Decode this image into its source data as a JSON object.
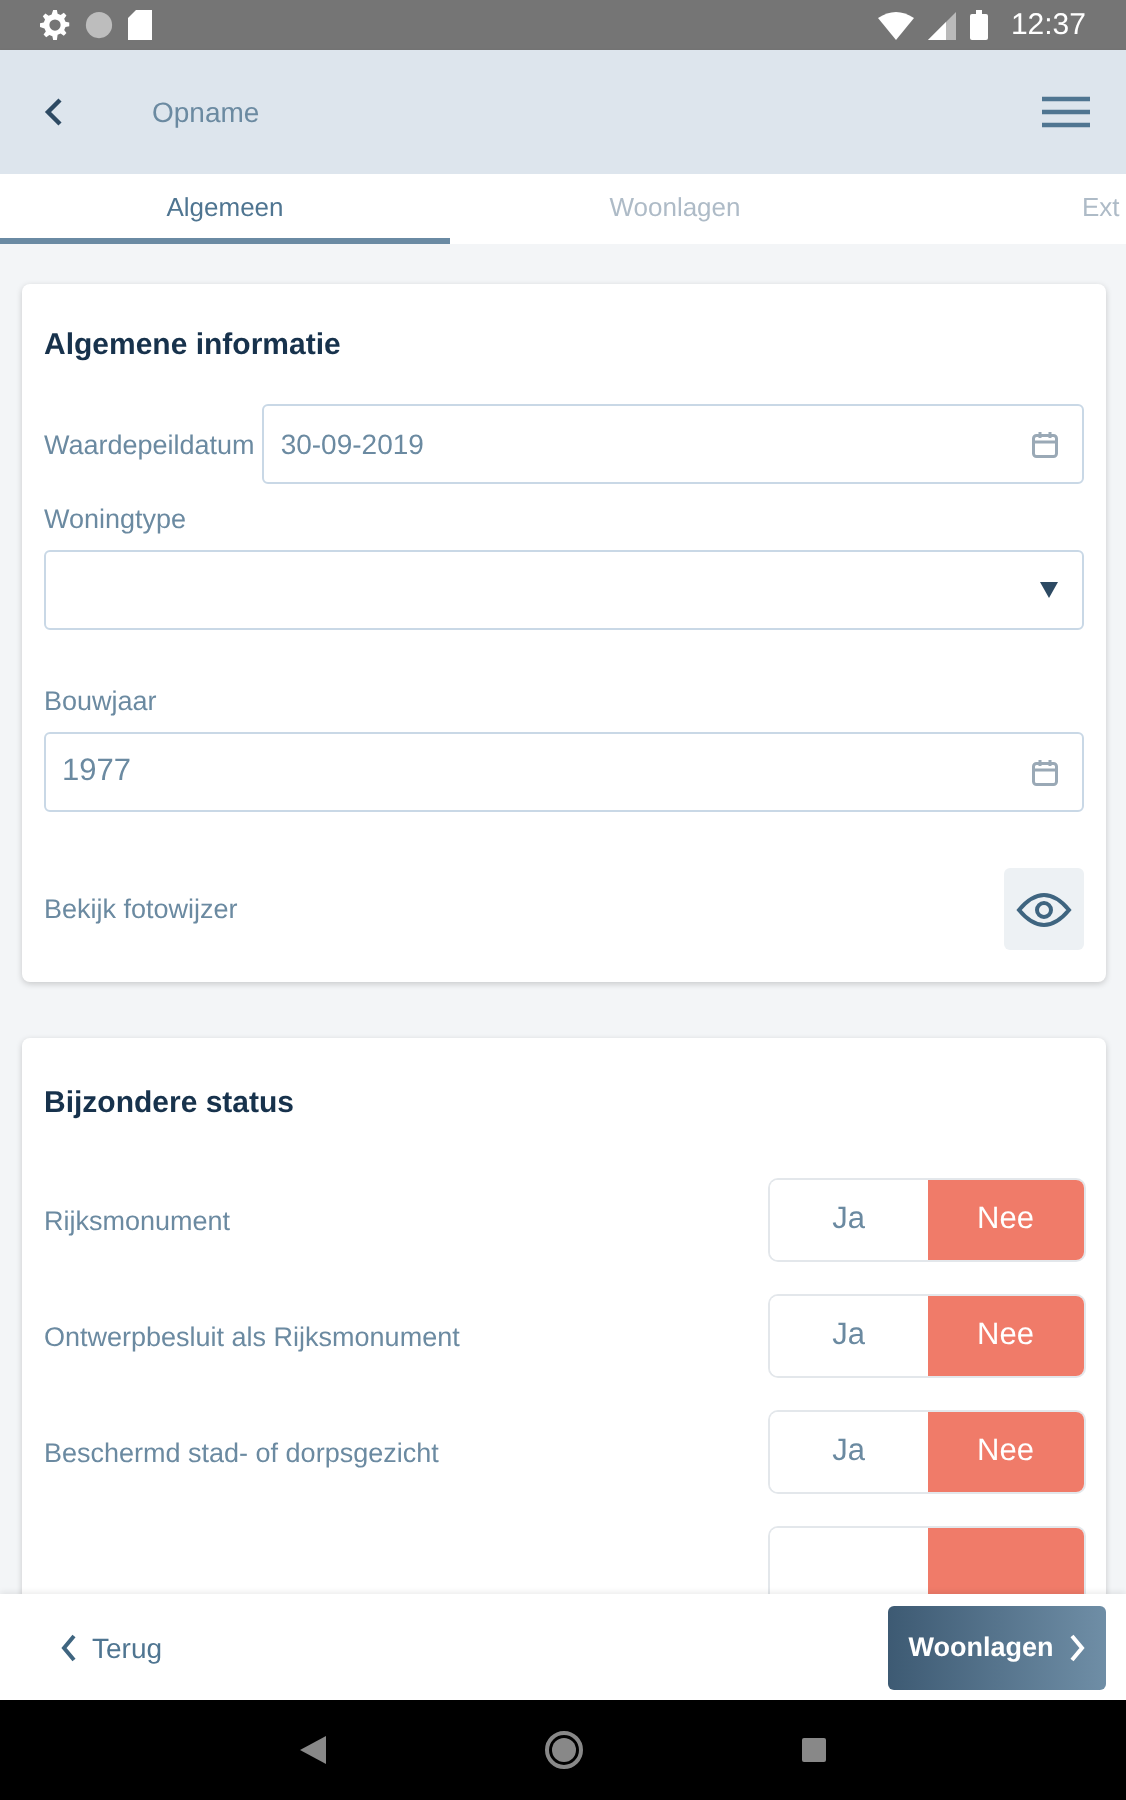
{
  "status_bar": {
    "time": "12:37"
  },
  "app_bar": {
    "title": "Opname"
  },
  "tabs": [
    {
      "label": "Algemeen",
      "selected": true
    },
    {
      "label": "Woonlagen",
      "selected": false
    },
    {
      "label": "Ext",
      "selected": false
    }
  ],
  "general_card": {
    "title": "Algemene informatie",
    "fields": [
      {
        "kind": "date-inline",
        "label": "Waardepeildatum",
        "value": "30-09-2019"
      },
      {
        "kind": "select",
        "label": "Woningtype"
      },
      {
        "kind": "date",
        "label": "Bouwjaar",
        "value": "1977"
      },
      {
        "kind": "view",
        "label": "Bekijk fotowijzer"
      }
    ]
  },
  "status_card": {
    "title": "Bijzondere status",
    "rows": [
      {
        "label": "Rijksmonument",
        "options": [
          {
            "label": "Ja",
            "selected": false
          },
          {
            "label": "Nee",
            "selected": true
          }
        ]
      },
      {
        "label": "Ontwerpbesluit als Rijksmonument",
        "options": [
          {
            "label": "Ja",
            "selected": false
          },
          {
            "label": "Nee",
            "selected": true
          }
        ]
      },
      {
        "label": "Beschermd stad- of dorpsgezicht",
        "options": [
          {
            "label": "Ja",
            "selected": false
          },
          {
            "label": "Nee",
            "selected": true
          }
        ]
      },
      {
        "options": [
          {
            "selected": false
          },
          {
            "selected": true
          }
        ]
      }
    ]
  },
  "footer": {
    "back": "Terug",
    "next": "Woonlagen"
  }
}
